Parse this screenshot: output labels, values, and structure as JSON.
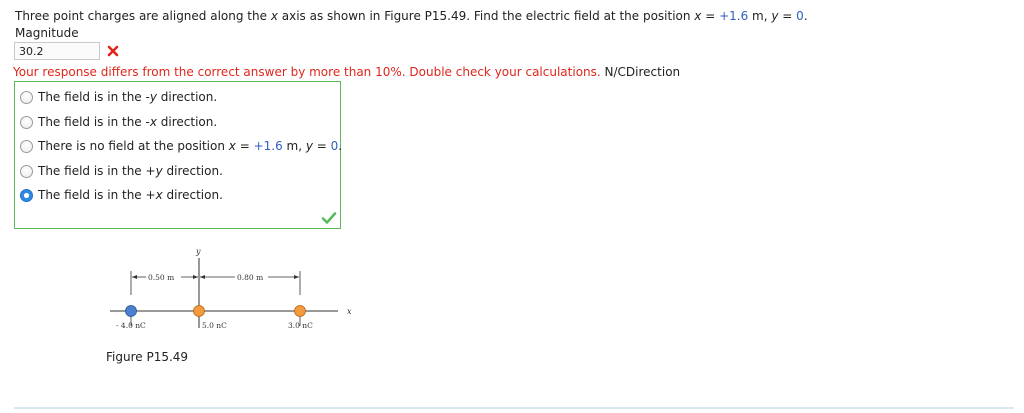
{
  "question": {
    "lead": "Three point charges are aligned along the ",
    "axis_var": "x",
    "mid": " axis as shown in Figure P15.49. Find the electric field at the position ",
    "x_var": "x",
    "x_eq": " = ",
    "x_value": "+1.6",
    "x_unit": " m, ",
    "y_var": "y",
    "y_eq": " = ",
    "y_value": "0",
    "end": "."
  },
  "magnitude": {
    "label": "Magnitude",
    "value": "30.2",
    "status_icon": "cross-icon",
    "status_color": "#e0261b"
  },
  "feedback": {
    "message": "Your response differs from the correct answer by more than 10%. Double check your calculations.",
    "direction_label": " N/CDirection",
    "color": "#e0261b"
  },
  "choices": [
    {
      "pre": "The field is in the -",
      "var": "y",
      "post": " direction.",
      "selected": false
    },
    {
      "pre": "The field is in the -",
      "var": "x",
      "post": " direction.",
      "selected": false
    },
    {
      "pre": "There is no field at the position ",
      "var": "x",
      "mid": " = ",
      "value": "+1.6",
      "unit": " m, ",
      "var2": "y",
      "mid2": " = ",
      "value2": "0",
      "post": ".",
      "selected": false
    },
    {
      "pre": "The field is in the +",
      "var": "y",
      "post": " direction.",
      "selected": false
    },
    {
      "pre": "The field is in the +",
      "var": "x",
      "post": " direction.",
      "selected": true
    }
  ],
  "choices_status": {
    "icon": "check-icon",
    "color": "#5cb85c",
    "border_color": "#5cb85c"
  },
  "figure": {
    "axis_x_label": "x",
    "axis_y_label": "y",
    "dim1": "0.50 m",
    "dim2": "0.80 m",
    "charges": [
      {
        "label": "- 4.0 nC",
        "color": "#4a7fd0"
      },
      {
        "label": "5.0 nC",
        "color": "#f29a3c"
      },
      {
        "label": "3.0 nC",
        "color": "#f29a3c"
      }
    ],
    "caption": "Figure P15.49"
  }
}
